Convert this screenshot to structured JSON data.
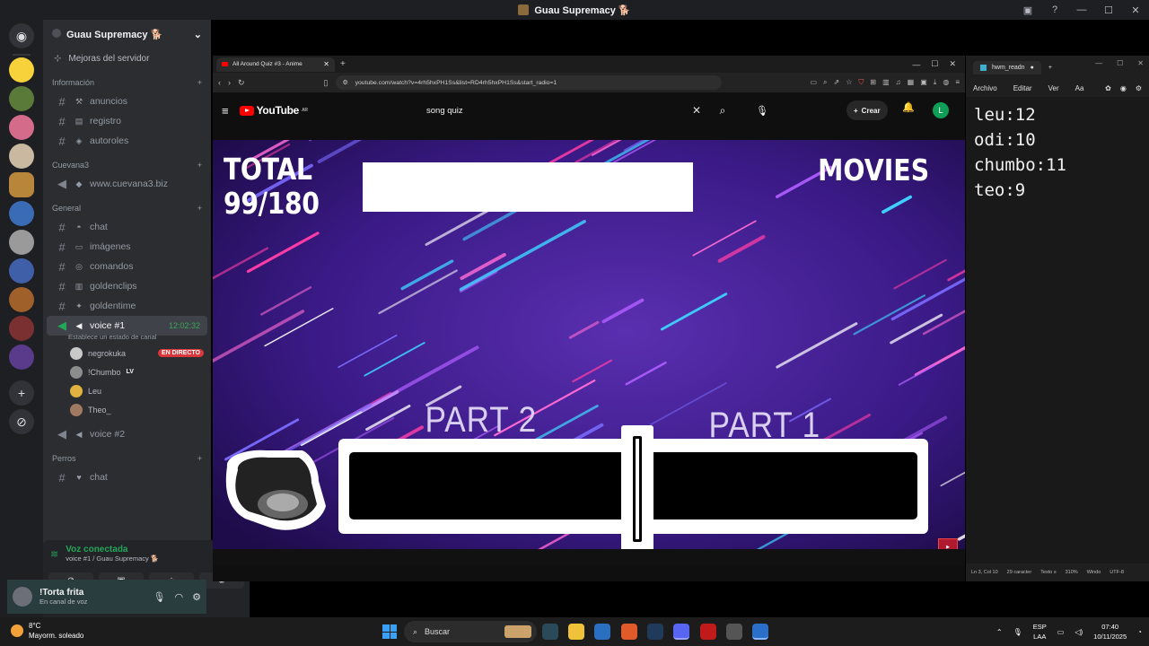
{
  "titlebar": {
    "title": "Guau Supremacy 🐕"
  },
  "sidebar": {
    "server_name": "Guau Supremacy 🐕",
    "boost": "Mejoras del servidor",
    "categories": [
      {
        "name": "Información",
        "channels": [
          "anuncios",
          "registro",
          "autoroles"
        ]
      },
      {
        "name": "Cuevana3",
        "channels": [
          "www.cuevana3.biz"
        ]
      },
      {
        "name": "General",
        "channels": [
          "chat",
          "imágenes",
          "comandos",
          "goldenclips",
          "goldentime"
        ]
      },
      {
        "name": "Perros",
        "channels": [
          "chat",
          "voice"
        ]
      }
    ],
    "voice_active": {
      "name": "voice #1",
      "time": "12:02:32",
      "status": "Establece un estado de canal"
    },
    "voice_users": [
      {
        "name": "negrokuka",
        "badge": "EN DIRECTO"
      },
      {
        "name": "!Chumbo",
        "badge": "LV"
      },
      {
        "name": "Leu"
      },
      {
        "name": "Theo_"
      }
    ],
    "voice_other": "voice #2"
  },
  "voice_panel": {
    "title": "Voz conectada",
    "subtitle": "voice #1 / Guau Supremacy 🐕"
  },
  "user": {
    "name": "!Torta frita",
    "status": "En canal de voz"
  },
  "browser": {
    "tab_title": "All Around Quiz #3 - Anime",
    "url": "youtube.com/watch?v=4rh5hxPH1Ss&list=RD4rh5hxPH1Ss&start_radio=1",
    "yt_brand": "YouTube",
    "yt_region": "AR",
    "search_value": "song quiz",
    "create_label": "Crear",
    "avatar_letter": "L"
  },
  "video": {
    "total_label": "TOTAL",
    "total_value": "99/180",
    "category": "MOVIES",
    "part_left": "PART 2",
    "part_right": "PART 1",
    "progress_fraction": 0.61
  },
  "notepad": {
    "tab_title": "hwm_readn",
    "menu": [
      "Archivo",
      "Editar",
      "Ver"
    ],
    "lines": [
      "leu:12",
      "odi:10",
      "chumbo:11",
      "teo:9"
    ],
    "status": [
      "Ln 3, Col 10",
      "29 caracter",
      "Texto s",
      "310%",
      "Windo",
      "UTF-8"
    ]
  },
  "taskbar": {
    "temp": "8°C",
    "weather": "Mayorm. soleado",
    "search_placeholder": "Buscar",
    "lang_top": "ESP",
    "lang_bottom": "LAA",
    "time": "07:40",
    "date": "10/11/2025"
  }
}
